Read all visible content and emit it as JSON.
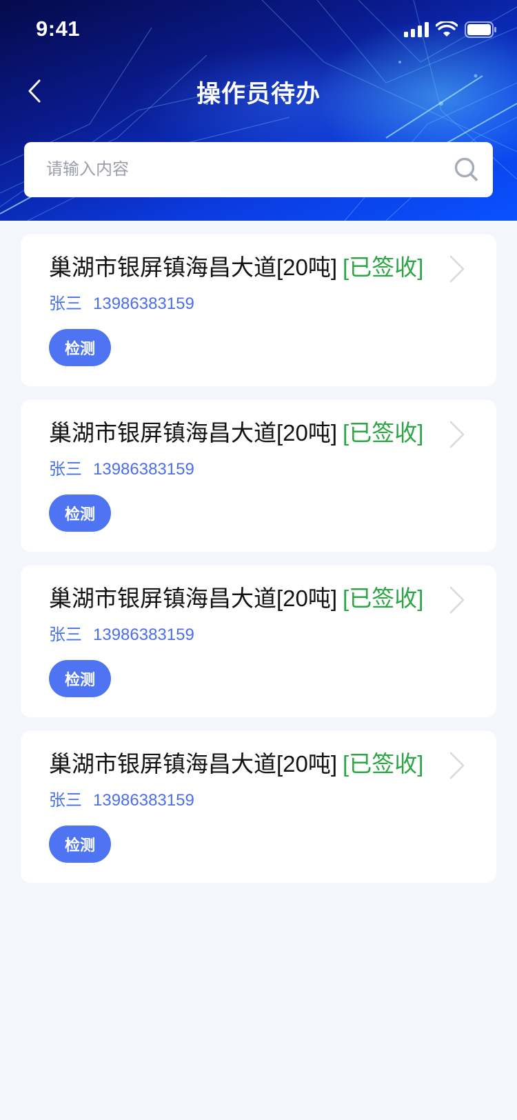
{
  "status_bar": {
    "time": "9:41",
    "icons": [
      "signal-icon",
      "wifi-icon",
      "battery-icon"
    ]
  },
  "nav": {
    "title": "操作员待办",
    "back_icon": "chevron-left-icon"
  },
  "search": {
    "placeholder": "请输入内容",
    "value": "",
    "icon": "search-icon"
  },
  "colors": {
    "accent_blue": "#4e74f3",
    "status_green": "#2aa744",
    "sub_text_blue": "#4a6ee8",
    "page_bg": "#f3f6fd"
  },
  "tasks": [
    {
      "address": "巢湖市银屏镇海昌大道[20吨]",
      "status": "[已签收]",
      "name": "张三",
      "phone": "13986383159",
      "action": "检测"
    },
    {
      "address": "巢湖市银屏镇海昌大道[20吨]",
      "status": "[已签收]",
      "name": "张三",
      "phone": "13986383159",
      "action": "检测"
    },
    {
      "address": "巢湖市银屏镇海昌大道[20吨]",
      "status": "[已签收]",
      "name": "张三",
      "phone": "13986383159",
      "action": "检测"
    },
    {
      "address": "巢湖市银屏镇海昌大道[20吨]",
      "status": "[已签收]",
      "name": "张三",
      "phone": "13986383159",
      "action": "检测"
    }
  ]
}
